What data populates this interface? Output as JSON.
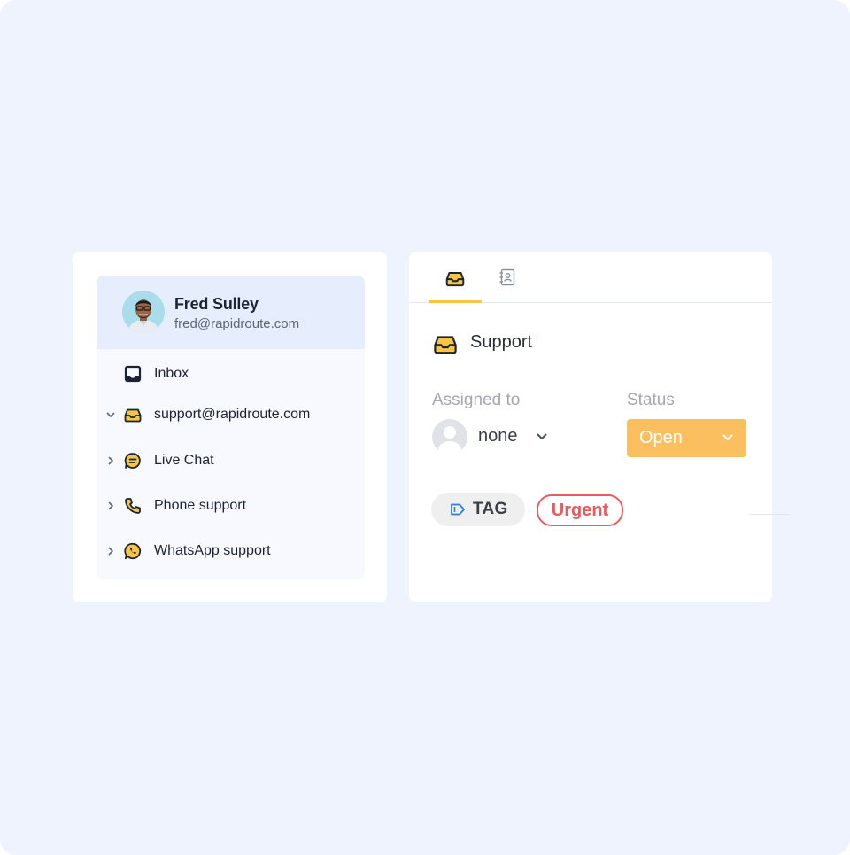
{
  "user": {
    "name": "Fred Sulley",
    "email": "fred@rapidroute.com"
  },
  "sidebar": {
    "items": [
      {
        "label": "Inbox",
        "icon": "inbox-icon",
        "expander": "none"
      },
      {
        "label": "support@rapidroute.com",
        "icon": "mailbox-tray-icon",
        "expander": "expanded"
      },
      {
        "label": "Live Chat",
        "icon": "chat-bubble-icon",
        "expander": "collapsed"
      },
      {
        "label": "Phone support",
        "icon": "phone-icon",
        "expander": "collapsed"
      },
      {
        "label": "WhatsApp support",
        "icon": "whatsapp-icon",
        "expander": "collapsed"
      }
    ]
  },
  "details": {
    "tabs": [
      {
        "icon": "inbox-tray-icon",
        "active": true
      },
      {
        "icon": "contact-book-icon",
        "active": false
      }
    ],
    "section_title": "Support",
    "assigned_label": "Assigned to",
    "assignee_value": "none",
    "status_label": "Status",
    "status_value": "Open",
    "tag_label": "TAG",
    "tags": [
      "Urgent"
    ]
  },
  "colors": {
    "background": "#eef3fe",
    "accent_yellow": "#f6c544",
    "status_open": "#fbbf5f",
    "urgent_red": "#ec5b5b",
    "tag_blue": "#2f7be6"
  }
}
